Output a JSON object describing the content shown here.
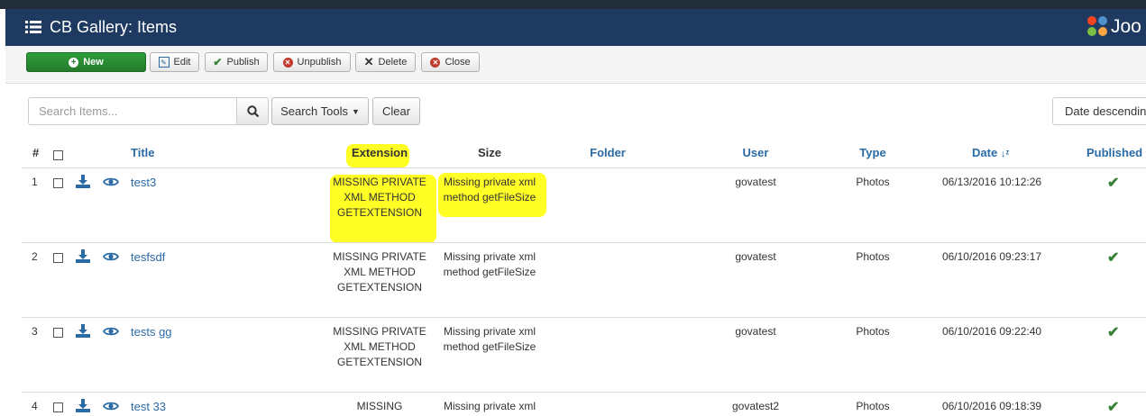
{
  "header": {
    "title": "CB Gallery: Items",
    "brand": "Joo"
  },
  "toolbar": {
    "new": "New",
    "edit": "Edit",
    "publish": "Publish",
    "unpublish": "Unpublish",
    "delete": "Delete",
    "close": "Close"
  },
  "filters": {
    "search_placeholder": "Search Items...",
    "search_tools": "Search Tools",
    "clear": "Clear",
    "sort": "Date descending"
  },
  "table": {
    "columns": {
      "num": "#",
      "title": "Title",
      "extension": "Extension",
      "size": "Size",
      "folder": "Folder",
      "user": "User",
      "type": "Type",
      "date": "Date",
      "published": "Published"
    },
    "rows": [
      {
        "num": "1",
        "title": "test3",
        "extension": "MISSING PRIVATE XML METHOD GETEXTENSION",
        "size": "Missing private xml method getFileSize",
        "folder": "",
        "user": "govatest",
        "type": "Photos",
        "date": "06/13/2016 10:12:26"
      },
      {
        "num": "2",
        "title": "tesfsdf",
        "extension": "MISSING PRIVATE XML METHOD GETEXTENSION",
        "size": "Missing private xml method getFileSize",
        "folder": "",
        "user": "govatest",
        "type": "Photos",
        "date": "06/10/2016 09:23:17"
      },
      {
        "num": "3",
        "title": "tests gg",
        "extension": "MISSING PRIVATE XML METHOD GETEXTENSION",
        "size": "Missing private xml method getFileSize",
        "folder": "",
        "user": "govatest",
        "type": "Photos",
        "date": "06/10/2016 09:22:40"
      },
      {
        "num": "4",
        "title": "test 33",
        "extension": "MISSING",
        "size": "Missing private xml",
        "folder": "",
        "user": "govatest2",
        "type": "Photos",
        "date": "06/10/2016 09:18:39"
      }
    ]
  },
  "colors": {
    "header_bg": "#1f3a60",
    "link": "#2a6aa5",
    "published_check": "#378137",
    "new_button": "#2f9e3b",
    "highlight": "#ffff00"
  }
}
